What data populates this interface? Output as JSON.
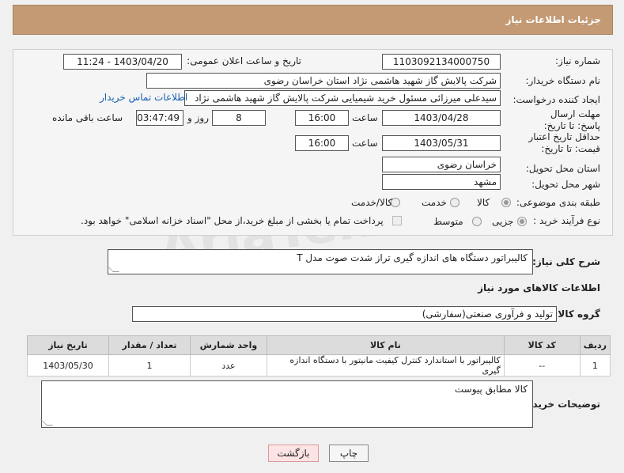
{
  "header": {
    "title": "جزئیات اطلاعات نیاز"
  },
  "form": {
    "need_number_label": "شماره نیاز:",
    "need_number": "1103092134000750",
    "announce_label": "تاریخ و ساعت اعلان عمومی:",
    "announce_value": "1403/04/20 - 11:24",
    "buyer_org_label": "نام دستگاه خریدار:",
    "buyer_org": "شرکت پالایش گاز شهید هاشمی نژاد   استان خراسان رضوی",
    "requester_label": "ایجاد کننده درخواست:",
    "requester": "سیدعلی میرزائی مسئول خرید شیمیایی شرکت پالایش گاز شهید هاشمی نژاد",
    "contact_link": "اطلاعات تماس خریدار",
    "reply_deadline_label": "مهلت ارسال پاسخ: تا تاریخ:",
    "reply_date": "1403/04/28",
    "time_label": "ساعت",
    "reply_time": "16:00",
    "days": "8",
    "days_label": "روز و",
    "remaining_time": "03:47:49",
    "remaining_label": "ساعت باقی مانده",
    "validity_label": "حداقل تاریخ اعتبار قیمت: تا تاریخ:",
    "validity_date": "1403/05/31",
    "validity_time": "16:00",
    "province_label": "استان محل تحویل:",
    "province": "خراسان رضوی",
    "city_label": "شهر محل تحویل:",
    "city": "مشهد",
    "category_label": "طبقه بندی موضوعی:",
    "category_options": [
      "کالا",
      "خدمت",
      "کالا/خدمت"
    ],
    "process_label": "نوع فرآیند خرید :",
    "process_options": [
      "جزیی",
      "متوسط"
    ],
    "payment_note": "پرداخت تمام یا بخشی از مبلغ خرید،از محل \"اسناد خزانه اسلامی\" خواهد بود."
  },
  "description": {
    "label": "شرح کلی نیاز:",
    "value": "کالیبراتور دستگاه های اندازه گیری تراز شدت صوت مدل T"
  },
  "goods_info_title": "اطلاعات کالاهای مورد نیاز",
  "goods_group": {
    "label": "گروه کالا:",
    "value": "تولید و فرآوری صنعتی(سفارشی)"
  },
  "table": {
    "headers": [
      "ردیف",
      "کد کالا",
      "نام کالا",
      "واحد شمارش",
      "تعداد / مقدار",
      "تاریخ نیاز"
    ],
    "rows": [
      [
        "1",
        "--",
        "کالیبراتور با استاندارد کنترل کیفیت مانیتور با دستگاه اندازه گیری",
        "عدد",
        "1",
        "1403/05/30"
      ]
    ]
  },
  "buyer_notes": {
    "label": "توضیحات خریدار:",
    "value": "کالا مطابق پیوست"
  },
  "buttons": {
    "print": "چاپ",
    "back": "بازگشت"
  },
  "watermark": "AriaTender.neT"
}
